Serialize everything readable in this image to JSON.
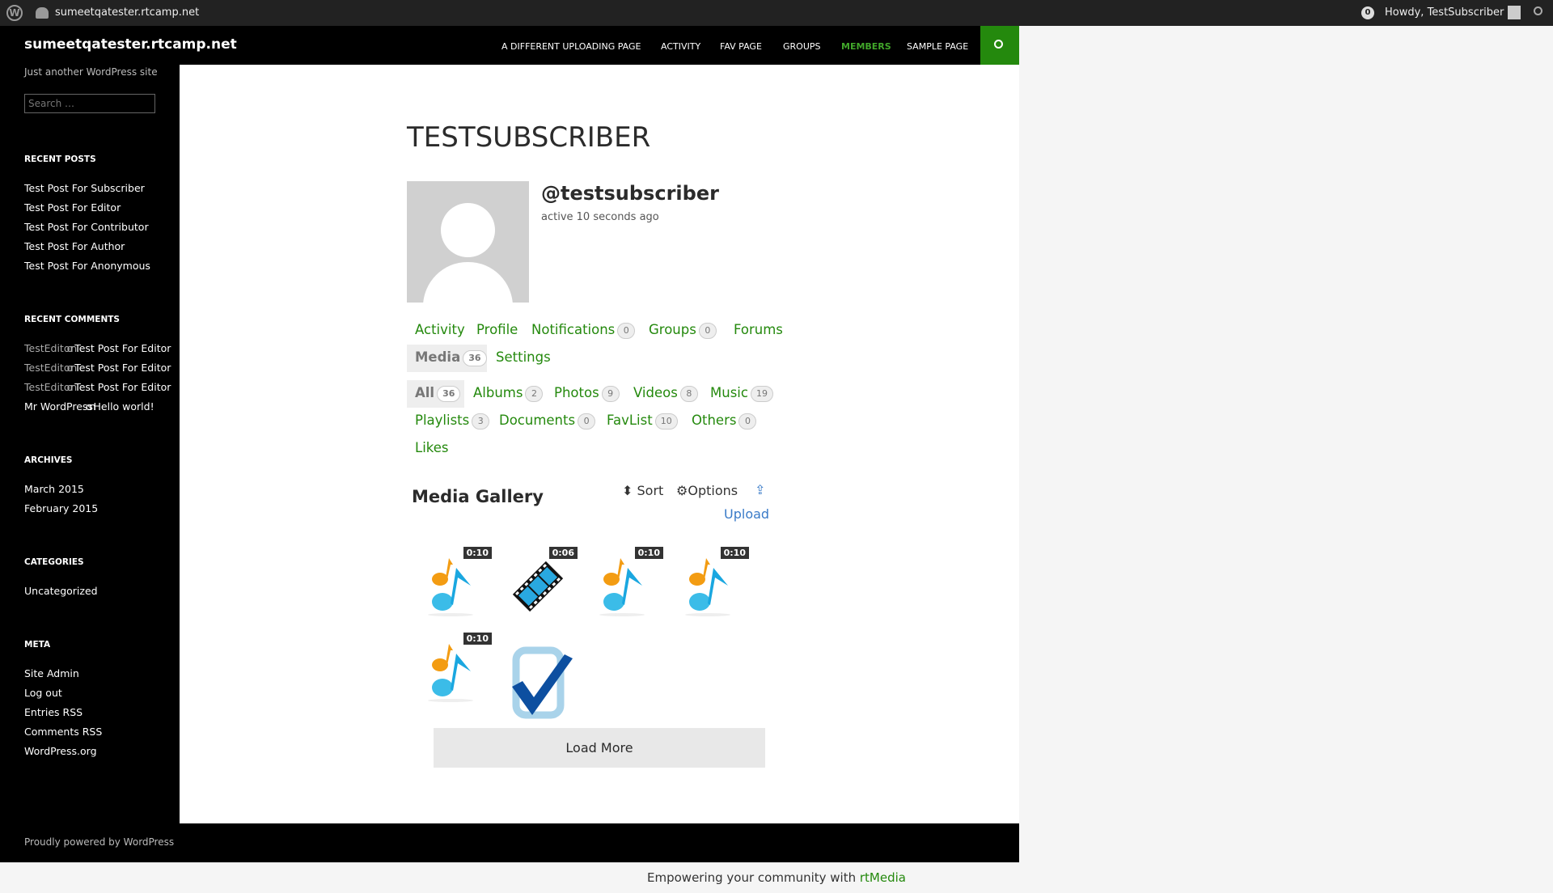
{
  "adminbar": {
    "site": "sumeetqatester.rtcamp.net",
    "notifications": "0",
    "howdy": "Howdy, TestSubscriber"
  },
  "header": {
    "site_title": "sumeetqatester.rtcamp.net",
    "nav": [
      "A DIFFERENT UPLOADING PAGE",
      "ACTIVITY",
      "FAV PAGE",
      "GROUPS",
      "MEMBERS",
      "SAMPLE PAGE"
    ],
    "active_nav": "MEMBERS",
    "accent": "#24890d"
  },
  "sidebar": {
    "tagline": "Just another WordPress site",
    "search_placeholder": "Search …",
    "recent_posts": {
      "title": "RECENT POSTS",
      "items": [
        "Test Post For Subscriber",
        "Test Post For Editor",
        "Test Post For Contributor",
        "Test Post For Author",
        "Test Post For Anonymous"
      ]
    },
    "recent_comments": {
      "title": "RECENT COMMENTS",
      "items": [
        {
          "author": "TestEditor",
          "on": "on",
          "post": "Test Post For Editor"
        },
        {
          "author": "TestEditor",
          "on": "on",
          "post": "Test Post For Editor"
        },
        {
          "author": "TestEditor",
          "on": "on",
          "post": "Test Post For Editor"
        },
        {
          "author": "Mr WordPress",
          "on": "on",
          "post": "Hello world!"
        }
      ]
    },
    "archives": {
      "title": "ARCHIVES",
      "items": [
        "March 2015",
        "February 2015"
      ]
    },
    "categories": {
      "title": "CATEGORIES",
      "items": [
        "Uncategorized"
      ]
    },
    "meta": {
      "title": "META",
      "items": [
        "Site Admin",
        "Log out",
        "Entries RSS",
        "Comments RSS",
        "WordPress.org"
      ]
    }
  },
  "profile": {
    "title": "TESTSUBSCRIBER",
    "username": "@testsubscriber",
    "activity": "active 10 seconds ago",
    "tabs": [
      {
        "label": "Activity"
      },
      {
        "label": "Profile"
      },
      {
        "label": "Notifications",
        "count": "0"
      },
      {
        "label": "Groups",
        "count": "0"
      },
      {
        "label": "Forums"
      },
      {
        "label": "Media",
        "count": "36",
        "active": true
      },
      {
        "label": "Settings"
      }
    ],
    "media_tabs": [
      {
        "label": "All",
        "count": "36",
        "active": true
      },
      {
        "label": "Albums",
        "count": "2"
      },
      {
        "label": "Photos",
        "count": "9"
      },
      {
        "label": "Videos",
        "count": "8"
      },
      {
        "label": "Music",
        "count": "19"
      },
      {
        "label": "Playlists",
        "count": "3"
      },
      {
        "label": "Documents",
        "count": "0"
      },
      {
        "label": "FavList",
        "count": "10"
      },
      {
        "label": "Others",
        "count": "0"
      },
      {
        "label": "Likes"
      }
    ]
  },
  "gallery": {
    "title": "Media Gallery",
    "sort": "Sort",
    "options": "Options",
    "upload": "Upload",
    "load_more": "Load More",
    "items": [
      {
        "type": "music",
        "duration": "0:10"
      },
      {
        "type": "video",
        "duration": "0:06"
      },
      {
        "type": "music",
        "duration": "0:10"
      },
      {
        "type": "music",
        "duration": "0:10"
      },
      {
        "type": "music",
        "duration": "0:10"
      },
      {
        "type": "document"
      }
    ]
  },
  "footer": {
    "powered": "Proudly powered by WordPress",
    "rtmedia_prefix": "Empowering your community with ",
    "rtmedia_link": "rtMedia"
  }
}
